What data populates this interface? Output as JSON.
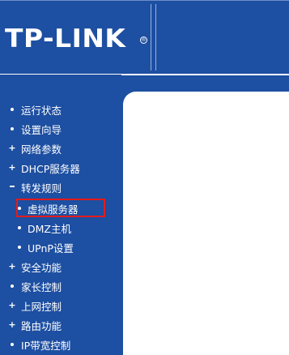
{
  "brand": {
    "logo": "TP-LINK",
    "registered_mark": "®"
  },
  "nav": {
    "items": [
      {
        "label": "运行状态",
        "bullet": "dot"
      },
      {
        "label": "设置向导",
        "bullet": "dot"
      },
      {
        "label": "网络参数",
        "bullet": "plus"
      },
      {
        "label": "DHCP服务器",
        "bullet": "plus"
      },
      {
        "label": "转发规则",
        "bullet": "minus"
      },
      {
        "label": "虚拟服务器",
        "bullet": "dot",
        "sub": true,
        "selected": true
      },
      {
        "label": "DMZ主机",
        "bullet": "dot",
        "sub": true
      },
      {
        "label": "UPnP设置",
        "bullet": "dot",
        "sub": true
      },
      {
        "label": "安全功能",
        "bullet": "plus"
      },
      {
        "label": "家长控制",
        "bullet": "dot"
      },
      {
        "label": "上网控制",
        "bullet": "plus"
      },
      {
        "label": "路由功能",
        "bullet": "plus"
      },
      {
        "label": "IP带宽控制",
        "bullet": "dot"
      }
    ]
  },
  "colors": {
    "background": "#1d4fa2",
    "highlight_border": "#e41b1b",
    "content_background": "#ffffff"
  }
}
